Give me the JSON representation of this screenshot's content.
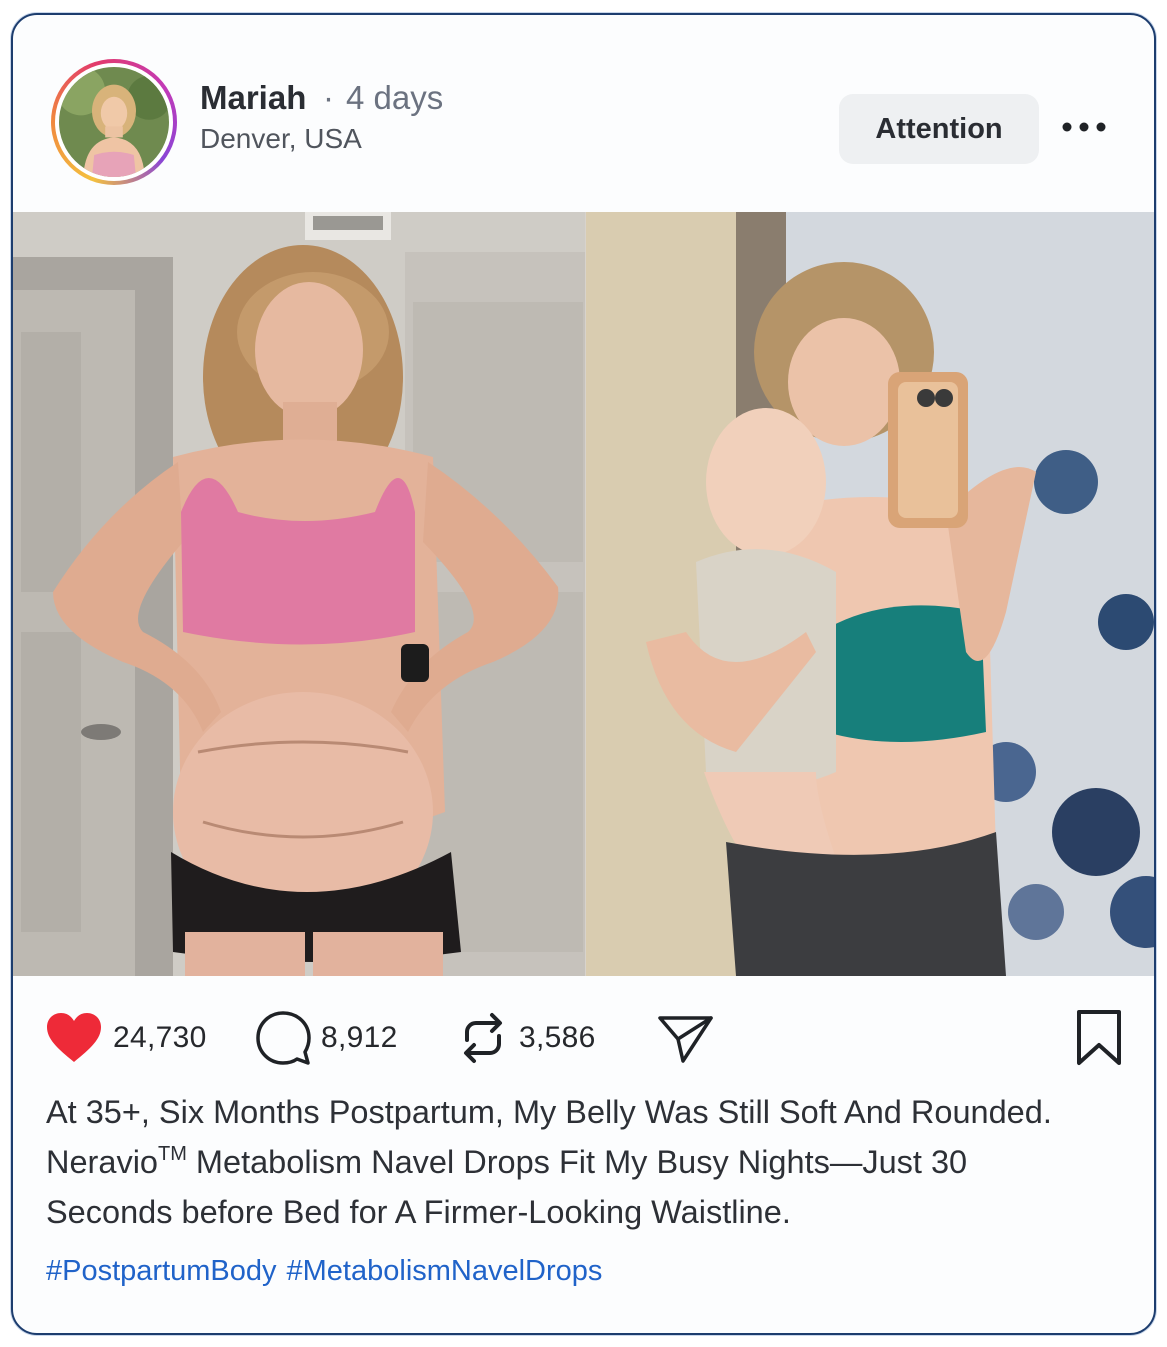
{
  "post": {
    "user": {
      "name": "Mariah",
      "separator": "·",
      "time": "4 days",
      "location": "Denver, USA"
    },
    "follow_button_label": "Attention",
    "more_icon": "more-dots-icon",
    "photos": [
      {
        "name": "before-photo"
      },
      {
        "name": "after-photo"
      }
    ],
    "actions": {
      "like": {
        "icon": "heart-icon",
        "count": "24,730",
        "color": "#ee2a38"
      },
      "comment": {
        "icon": "comment-bubble-icon",
        "count": "8,912"
      },
      "repost": {
        "icon": "repost-icon",
        "count": "3,586"
      },
      "share": {
        "icon": "send-icon"
      },
      "bookmark": {
        "icon": "bookmark-icon"
      }
    },
    "caption": {
      "line1": "At 35+, Six Months Postpartum, My Belly Was Still Soft And Rounded.",
      "brand": "Neravio",
      "trademark": "TM",
      "line2": " Metabolism Navel Drops Fit My Busy Nights—Just 30",
      "line3": "Seconds before Bed for A Firmer-Looking Waistline."
    },
    "hashtags": [
      "#PostpartumBody",
      "#MetabolismNavelDrops"
    ],
    "hashtag_color": "#2063c9"
  }
}
